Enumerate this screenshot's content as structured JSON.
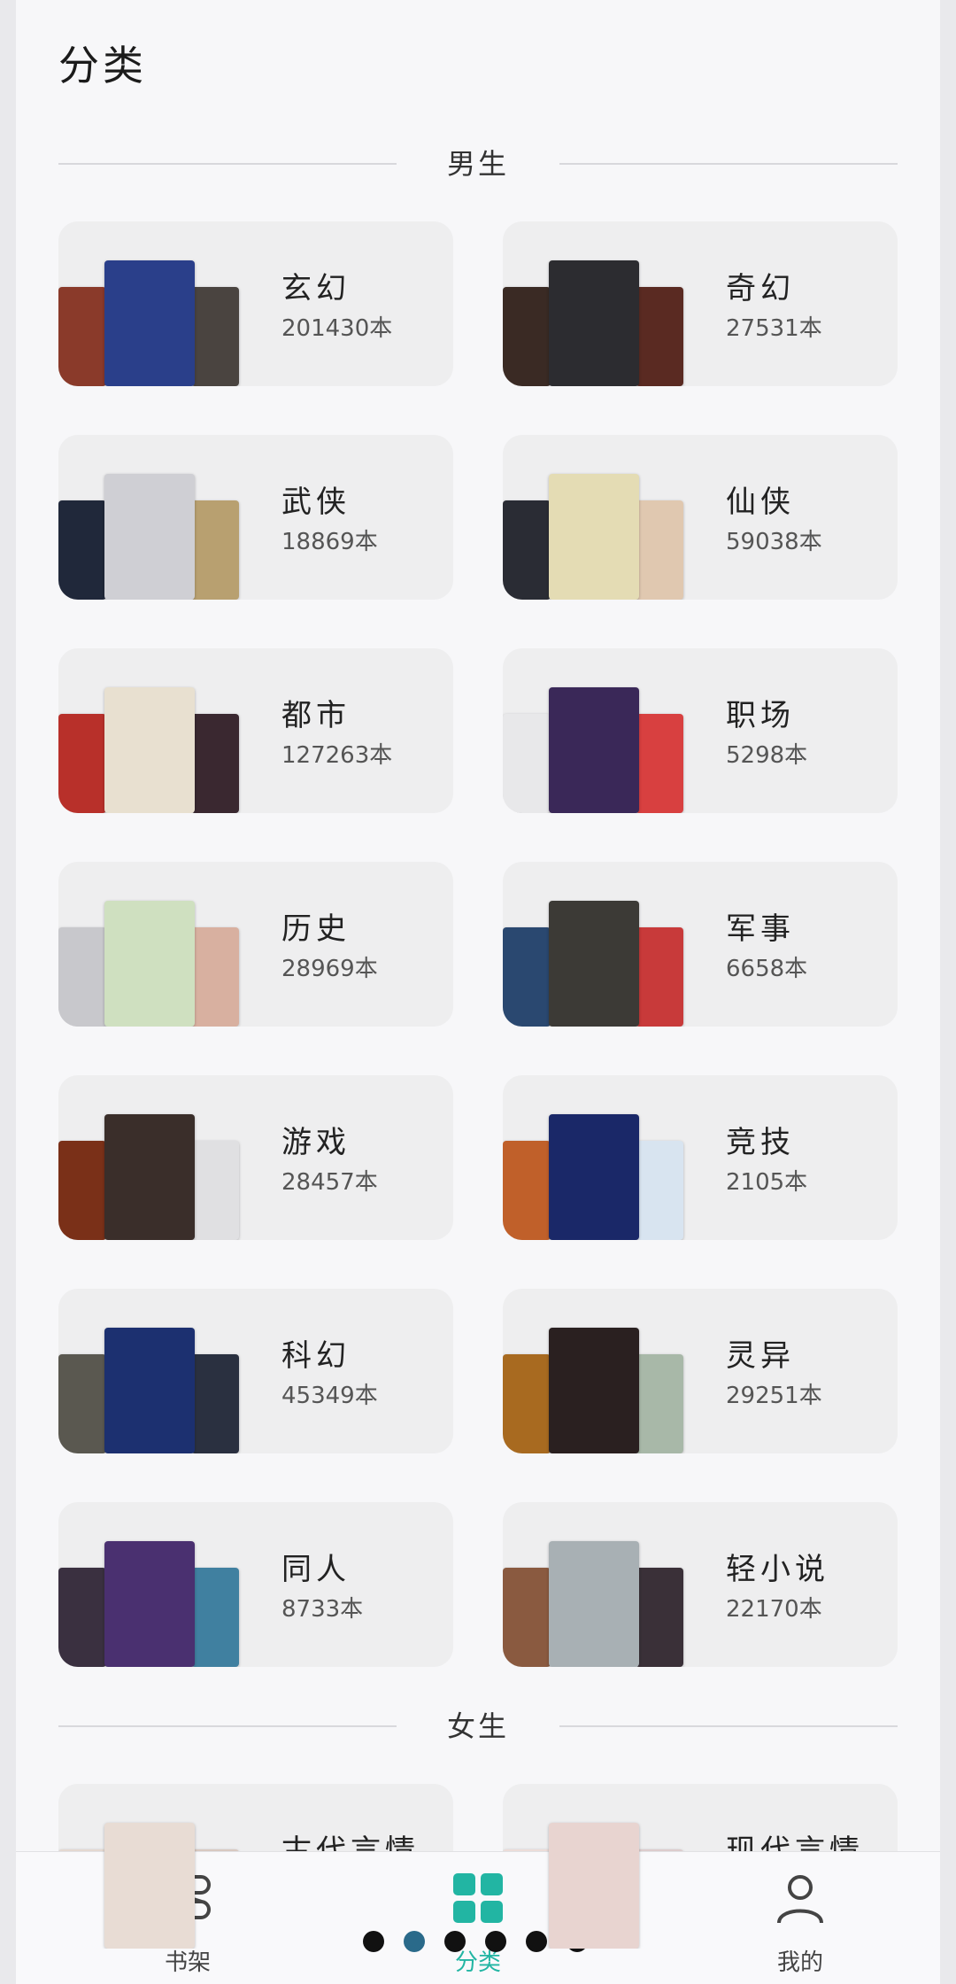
{
  "header": {
    "title": "分类"
  },
  "sections": [
    {
      "label": "男生"
    },
    {
      "label": "女生"
    }
  ],
  "male_categories": [
    {
      "name": "玄幻",
      "count": "201430本",
      "covers": [
        "#8a3a2a",
        "#2a3f8a",
        "#4a4440"
      ]
    },
    {
      "name": "奇幻",
      "count": "27531本",
      "covers": [
        "#3a2a24",
        "#2c2c30",
        "#5a2a22"
      ]
    },
    {
      "name": "武侠",
      "count": "18869本",
      "covers": [
        "#20283a",
        "#cfcfd4",
        "#b8a070"
      ]
    },
    {
      "name": "仙侠",
      "count": "59038本",
      "covers": [
        "#2a2c34",
        "#e4dcb4",
        "#e0c8b0"
      ]
    },
    {
      "name": "都市",
      "count": "127263本",
      "covers": [
        "#b8302a",
        "#e8e0d0",
        "#3a2830"
      ]
    },
    {
      "name": "职场",
      "count": "5298本",
      "covers": [
        "#e8e8ea",
        "#3a2858",
        "#d84040"
      ]
    },
    {
      "name": "历史",
      "count": "28969本",
      "covers": [
        "#c8c8cc",
        "#cfe0c0",
        "#d8b0a0"
      ]
    },
    {
      "name": "军事",
      "count": "6658本",
      "covers": [
        "#2a4870",
        "#3c3a36",
        "#c83a3a"
      ]
    },
    {
      "name": "游戏",
      "count": "28457本",
      "covers": [
        "#7a3018",
        "#3a2e2a",
        "#e0e0e2"
      ]
    },
    {
      "name": "竞技",
      "count": "2105本",
      "covers": [
        "#c0602a",
        "#1a2868",
        "#d8e4f0"
      ]
    },
    {
      "name": "科幻",
      "count": "45349本",
      "covers": [
        "#5a5850",
        "#1c3070",
        "#2a3040"
      ]
    },
    {
      "name": "灵异",
      "count": "29251本",
      "covers": [
        "#a86a20",
        "#2a2020",
        "#a8b8a8"
      ]
    },
    {
      "name": "同人",
      "count": "8733本",
      "covers": [
        "#3a3040",
        "#4a3070",
        "#4080a0"
      ]
    },
    {
      "name": "轻小说",
      "count": "22170本",
      "covers": [
        "#8a5a40",
        "#a8b0b4",
        "#3a3038"
      ]
    }
  ],
  "female_categories": [
    {
      "name": "古代言情",
      "covers": [
        "#e4d8d0",
        "#e8dcd4",
        "#d8c8c0"
      ]
    },
    {
      "name": "现代言情",
      "covers": [
        "#ecdcd8",
        "#e8d4d0",
        "#dccccc"
      ]
    }
  ],
  "bottom_nav": {
    "items": [
      {
        "label": "书架",
        "icon": "bookshelf-icon"
      },
      {
        "label": "分类",
        "icon": "category-grid-icon",
        "active": true
      },
      {
        "label": "我的",
        "icon": "profile-icon"
      }
    ]
  },
  "colors": {
    "accent": "#22b5a3",
    "card_bg": "#eeeeef",
    "background": "#f7f7f9"
  }
}
